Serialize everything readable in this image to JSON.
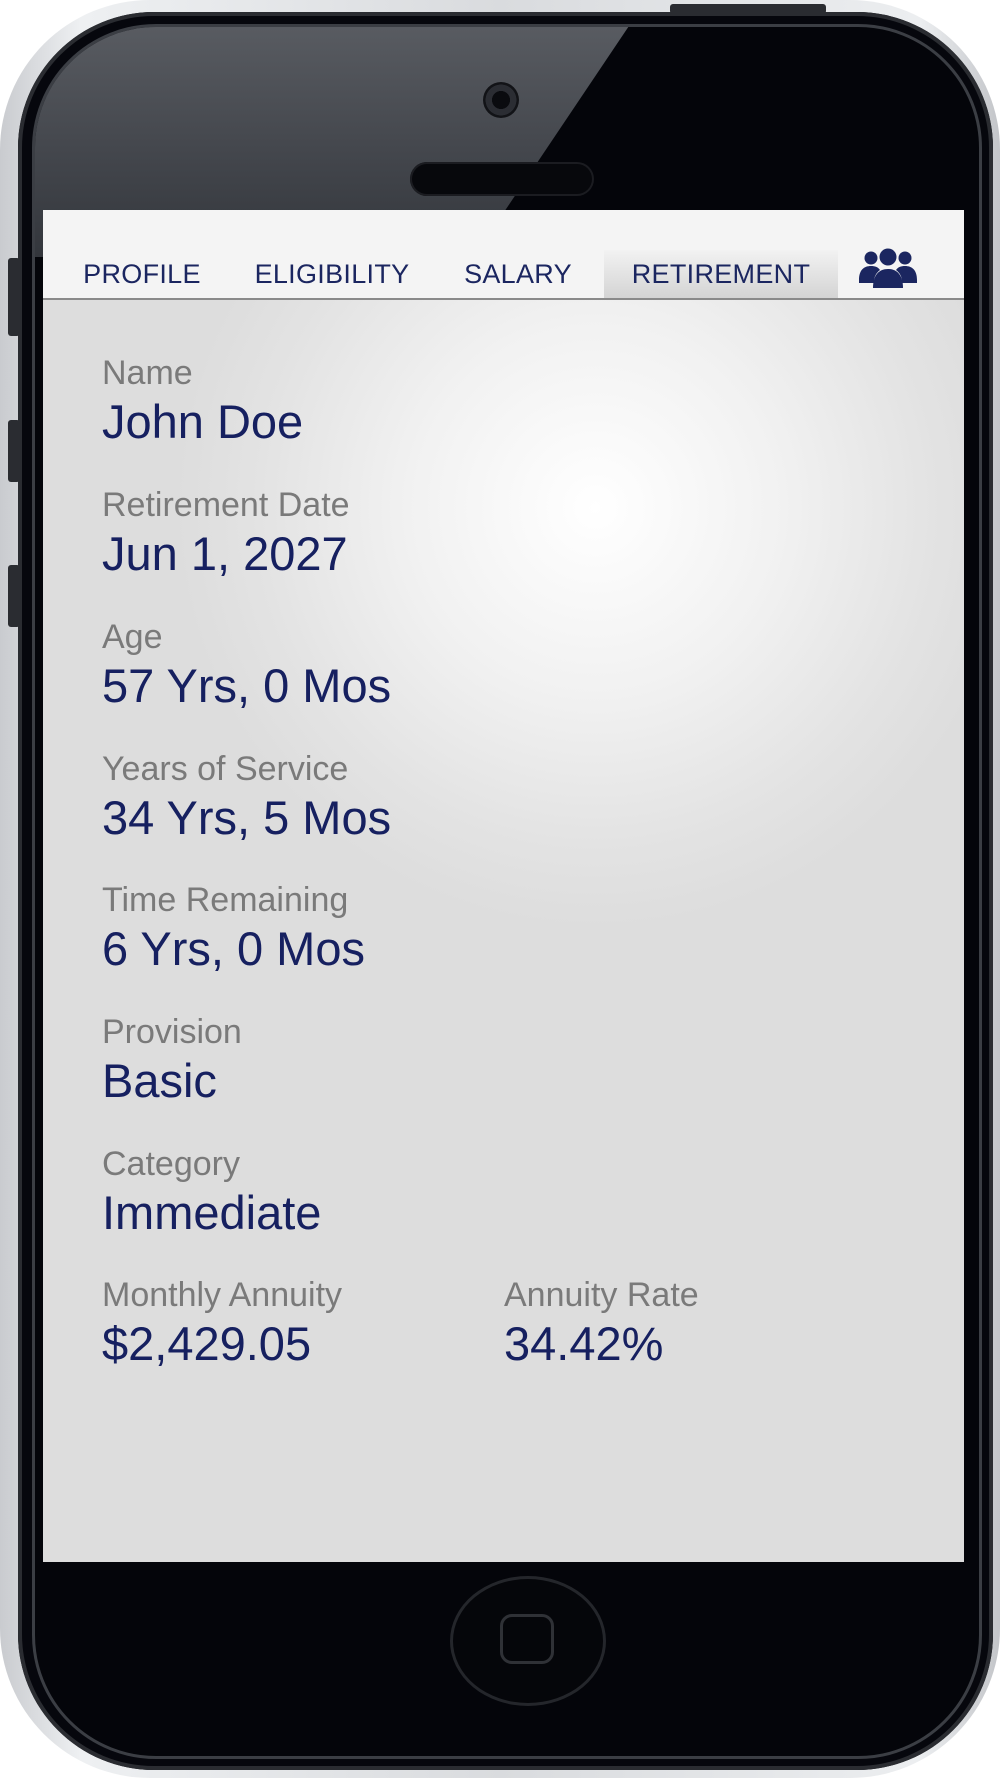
{
  "tabs": [
    {
      "label": "PROFILE",
      "active": false
    },
    {
      "label": "ELIGIBILITY",
      "active": false
    },
    {
      "label": "SALARY",
      "active": false
    },
    {
      "label": "RETIREMENT",
      "active": true
    }
  ],
  "team_icon": "people-group-icon",
  "fields": {
    "name": {
      "label": "Name",
      "value": "John Doe"
    },
    "retirement_date": {
      "label": "Retirement Date",
      "value": "Jun 1, 2027"
    },
    "age": {
      "label": "Age",
      "value": "57 Yrs, 0 Mos"
    },
    "years_of_service": {
      "label": "Years of Service",
      "value": "34 Yrs, 5 Mos"
    },
    "time_remaining": {
      "label": "Time Remaining",
      "value": "6 Yrs, 0 Mos"
    },
    "provision": {
      "label": "Provision",
      "value": "Basic"
    },
    "category": {
      "label": "Category",
      "value": "Immediate"
    },
    "monthly_annuity": {
      "label": "Monthly Annuity",
      "value": "$2,429.05"
    },
    "annuity_rate": {
      "label": "Annuity Rate",
      "value": "34.42%"
    }
  },
  "colors": {
    "value_text": "#162060",
    "label_text": "#7a7a7a",
    "tab_text": "#1b2660"
  }
}
